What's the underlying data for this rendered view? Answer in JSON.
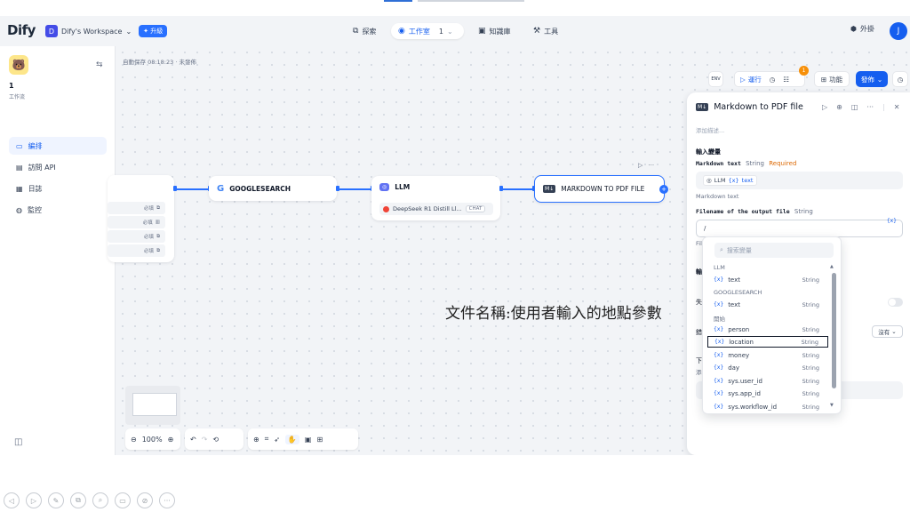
{
  "header": {
    "logo": "Dify",
    "workspace_initial": "D",
    "workspace_name": "Dify's Workspace",
    "upgrade_label": "✦ 升級",
    "nav": [
      {
        "label": "探索"
      },
      {
        "label": "工作室",
        "count": "1"
      },
      {
        "label": "知識庫"
      },
      {
        "label": "工具"
      }
    ],
    "plugin_label": "外掛",
    "user_initial": "J"
  },
  "sidebar": {
    "app_name": "1",
    "app_type": "工作流",
    "items": [
      {
        "label": "編排",
        "icon": "layout-icon"
      },
      {
        "label": "訪問 API",
        "icon": "terminal-icon"
      },
      {
        "label": "日誌",
        "icon": "document-icon"
      },
      {
        "label": "監控",
        "icon": "monitor-icon"
      }
    ]
  },
  "canvas": {
    "autosave": "自動保存 08:18:23 · 未發佈",
    "toolbar": {
      "env_label": "ENV",
      "run_label": "運行",
      "features_label": "功能",
      "publish_label": "發佈",
      "checklist_count": "1"
    },
    "start_rows": [
      "必填",
      "必填",
      "必填",
      "必填"
    ],
    "nodes": {
      "google": "GOOGLESEARCH",
      "llm": "LLM",
      "llm_model": "DeepSeek R1 Distill Ll...",
      "llm_mode": "CHAT",
      "md_pdf": "MARKDOWN TO PDF FILE"
    },
    "zoom": "100%",
    "overlay_text": "文件名稱:使用者輸入的地點參數"
  },
  "panel": {
    "title": "Markdown to PDF file",
    "description_placeholder": "添加描述...",
    "section_input": "輸入變量",
    "field1_label": "Markdown text",
    "field1_type": "String",
    "field1_required": "Required",
    "field1_pill_node": "LLM",
    "field1_pill_var": "text",
    "field1_hint": "Markdown text",
    "field2_label": "Filename of the output file",
    "field2_type": "String",
    "field2_value": "/",
    "field2_hint_partial": "Fil",
    "out_partial": "輸",
    "fail_partial": "失",
    "err_partial": "錯",
    "next_partial": "下",
    "add_partial": "添",
    "none_select": "沒有"
  },
  "dropdown": {
    "search_placeholder": "搜索變量",
    "groups": [
      {
        "name": "LLM",
        "items": [
          {
            "name": "text",
            "type": "String"
          }
        ]
      },
      {
        "name": "GOOGLESEARCH",
        "items": [
          {
            "name": "text",
            "type": "String"
          }
        ]
      },
      {
        "name": "開始",
        "items": [
          {
            "name": "person",
            "type": "String"
          },
          {
            "name": "location",
            "type": "String",
            "selected": true
          },
          {
            "name": "money",
            "type": "String"
          },
          {
            "name": "day",
            "type": "String"
          },
          {
            "name": "sys.user_id",
            "type": "String"
          },
          {
            "name": "sys.app_id",
            "type": "String"
          },
          {
            "name": "sys.workflow_id",
            "type": "String"
          }
        ]
      }
    ]
  }
}
